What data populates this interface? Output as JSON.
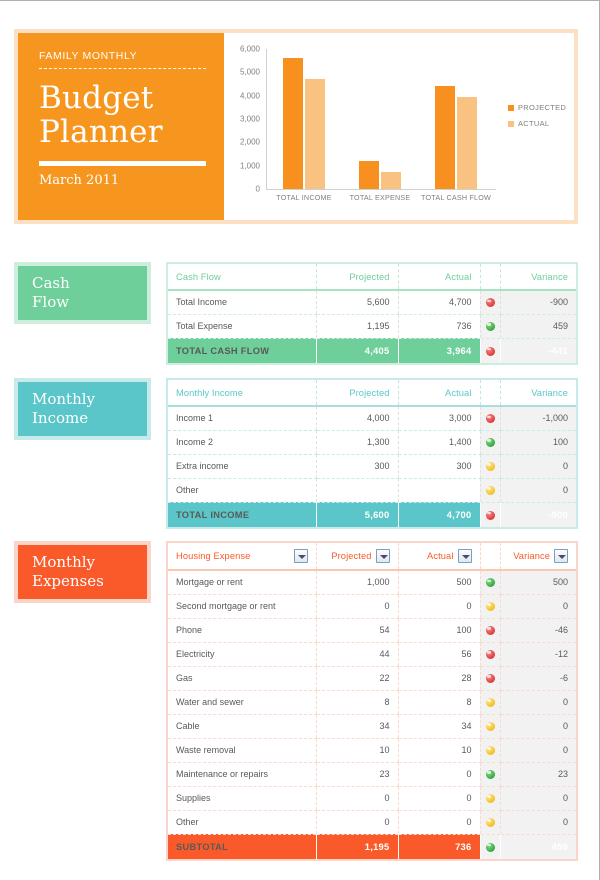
{
  "header": {
    "kicker": "FAMILY MONTHLY",
    "title_line1": "Budget",
    "title_line2": "Planner",
    "subtitle": "March 2011"
  },
  "chart_data": {
    "type": "bar",
    "title": "",
    "xlabel": "",
    "ylabel": "",
    "categories": [
      "TOTAL INCOME",
      "TOTAL EXPENSE",
      "TOTAL CASH FLOW"
    ],
    "series": [
      {
        "name": "PROJECTED",
        "color": "#f7901e",
        "values": [
          5600,
          1195,
          4405
        ]
      },
      {
        "name": "ACTUAL",
        "color": "#fac281",
        "values": [
          4700,
          736,
          3964
        ]
      }
    ],
    "ylim": [
      0,
      6000
    ],
    "yticks": [
      0,
      1000,
      2000,
      3000,
      4000,
      5000,
      6000
    ],
    "ytick_labels": [
      "0",
      "1,000",
      "2,000",
      "3,000",
      "4,000",
      "5,000",
      "6,000"
    ],
    "grid": false,
    "legend_position": "right"
  },
  "sections": {
    "cash_flow": {
      "label_line1": "Cash",
      "label_line2": "Flow",
      "accent": "#6ecf9a",
      "columns": [
        "Cash Flow",
        "Projected",
        "Actual",
        "Variance"
      ],
      "rows": [
        {
          "label": "Total Income",
          "projected": "5,600",
          "actual": "4,700",
          "status": "red",
          "variance": "-900"
        },
        {
          "label": "Total Expense",
          "projected": "1,195",
          "actual": "736",
          "status": "green",
          "variance": "459"
        }
      ],
      "total": {
        "label": "TOTAL CASH FLOW",
        "projected": "4,405",
        "actual": "3,964",
        "status": "red",
        "variance": "-441"
      }
    },
    "monthly_income": {
      "label_line1": "Monthly",
      "label_line2": "Income",
      "accent": "#5bc6c9",
      "columns": [
        "Monthly Income",
        "Projected",
        "Actual",
        "Variance"
      ],
      "rows": [
        {
          "label": "Income 1",
          "projected": "4,000",
          "actual": "3,000",
          "status": "red",
          "variance": "-1,000"
        },
        {
          "label": "Income 2",
          "projected": "1,300",
          "actual": "1,400",
          "status": "green",
          "variance": "100"
        },
        {
          "label": "Extra income",
          "projected": "300",
          "actual": "300",
          "status": "yellow",
          "variance": "0"
        },
        {
          "label": "Other",
          "projected": "",
          "actual": "",
          "status": "yellow",
          "variance": "0"
        }
      ],
      "total": {
        "label": "TOTAL INCOME",
        "projected": "5,600",
        "actual": "4,700",
        "status": "red",
        "variance": "-900"
      }
    },
    "monthly_expenses": {
      "label_line1": "Monthly",
      "label_line2": "Expenses",
      "accent": "#fa5a2a",
      "columns": [
        "Housing Expense",
        "Projected",
        "Actual",
        "Variance"
      ],
      "filterable": true,
      "rows": [
        {
          "label": "Mortgage or rent",
          "projected": "1,000",
          "actual": "500",
          "status": "green",
          "variance": "500"
        },
        {
          "label": "Second mortgage or rent",
          "projected": "0",
          "actual": "0",
          "status": "yellow",
          "variance": "0"
        },
        {
          "label": "Phone",
          "projected": "54",
          "actual": "100",
          "status": "red",
          "variance": "-46"
        },
        {
          "label": "Electricity",
          "projected": "44",
          "actual": "56",
          "status": "red",
          "variance": "-12"
        },
        {
          "label": "Gas",
          "projected": "22",
          "actual": "28",
          "status": "red",
          "variance": "-6"
        },
        {
          "label": "Water and sewer",
          "projected": "8",
          "actual": "8",
          "status": "yellow",
          "variance": "0"
        },
        {
          "label": "Cable",
          "projected": "34",
          "actual": "34",
          "status": "yellow",
          "variance": "0"
        },
        {
          "label": "Waste removal",
          "projected": "10",
          "actual": "10",
          "status": "yellow",
          "variance": "0"
        },
        {
          "label": "Maintenance or repairs",
          "projected": "23",
          "actual": "0",
          "status": "green",
          "variance": "23"
        },
        {
          "label": "Supplies",
          "projected": "0",
          "actual": "0",
          "status": "yellow",
          "variance": "0"
        },
        {
          "label": "Other",
          "projected": "0",
          "actual": "0",
          "status": "yellow",
          "variance": "0"
        }
      ],
      "total": {
        "label": "SUBTOTAL",
        "projected": "1,195",
        "actual": "736",
        "status": "green",
        "variance": "459"
      }
    }
  }
}
